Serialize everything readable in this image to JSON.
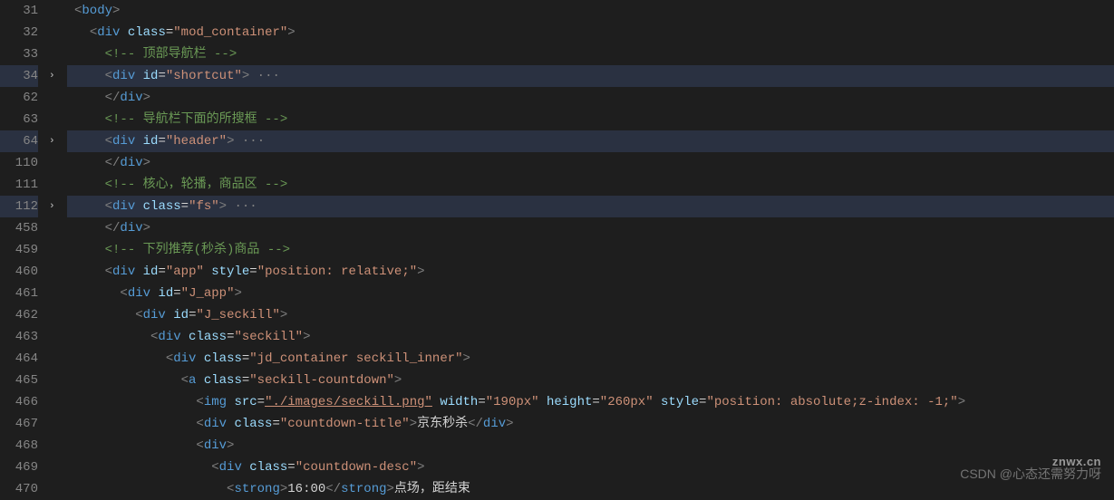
{
  "lines": [
    {
      "num": "31",
      "hl": false,
      "fold": false,
      "indent": 0,
      "tokens": [
        {
          "t": "tag-bracket",
          "v": "<"
        },
        {
          "t": "tag-name",
          "v": "body"
        },
        {
          "t": "tag-bracket",
          "v": ">"
        }
      ]
    },
    {
      "num": "32",
      "hl": false,
      "fold": false,
      "indent": 1,
      "tokens": [
        {
          "t": "tag-bracket",
          "v": "<"
        },
        {
          "t": "tag-name",
          "v": "div"
        },
        {
          "t": "text-content",
          "v": " "
        },
        {
          "t": "attr-name",
          "v": "class"
        },
        {
          "t": "text-content",
          "v": "="
        },
        {
          "t": "attr-value",
          "v": "\"mod_container\""
        },
        {
          "t": "tag-bracket",
          "v": ">"
        }
      ]
    },
    {
      "num": "33",
      "hl": false,
      "fold": false,
      "indent": 2,
      "tokens": [
        {
          "t": "comment",
          "v": "<!-- 顶部导航栏 -->"
        }
      ]
    },
    {
      "num": "34",
      "hl": true,
      "fold": true,
      "indent": 2,
      "tokens": [
        {
          "t": "tag-bracket",
          "v": "<"
        },
        {
          "t": "tag-name",
          "v": "div"
        },
        {
          "t": "text-content",
          "v": " "
        },
        {
          "t": "attr-name",
          "v": "id"
        },
        {
          "t": "text-content",
          "v": "="
        },
        {
          "t": "attr-value",
          "v": "\"shortcut\""
        },
        {
          "t": "tag-bracket",
          "v": ">"
        },
        {
          "t": "fold-dots",
          "v": " ···"
        }
      ]
    },
    {
      "num": "62",
      "hl": false,
      "fold": false,
      "indent": 2,
      "tokens": [
        {
          "t": "tag-bracket",
          "v": "</"
        },
        {
          "t": "tag-name",
          "v": "div"
        },
        {
          "t": "tag-bracket",
          "v": ">"
        }
      ]
    },
    {
      "num": "63",
      "hl": false,
      "fold": false,
      "indent": 2,
      "tokens": [
        {
          "t": "comment",
          "v": "<!-- 导航栏下面的所搜框 -->"
        }
      ]
    },
    {
      "num": "64",
      "hl": true,
      "fold": true,
      "indent": 2,
      "tokens": [
        {
          "t": "tag-bracket",
          "v": "<"
        },
        {
          "t": "tag-name",
          "v": "div"
        },
        {
          "t": "text-content",
          "v": " "
        },
        {
          "t": "attr-name",
          "v": "id"
        },
        {
          "t": "text-content",
          "v": "="
        },
        {
          "t": "attr-value",
          "v": "\"header\""
        },
        {
          "t": "tag-bracket",
          "v": ">"
        },
        {
          "t": "fold-dots",
          "v": " ···"
        }
      ]
    },
    {
      "num": "110",
      "hl": false,
      "fold": false,
      "indent": 2,
      "tokens": [
        {
          "t": "tag-bracket",
          "v": "</"
        },
        {
          "t": "tag-name",
          "v": "div"
        },
        {
          "t": "tag-bracket",
          "v": ">"
        }
      ]
    },
    {
      "num": "111",
      "hl": false,
      "fold": false,
      "indent": 2,
      "tokens": [
        {
          "t": "comment",
          "v": "<!-- 核心，轮播，商品区 -->"
        }
      ]
    },
    {
      "num": "112",
      "hl": true,
      "fold": true,
      "indent": 2,
      "tokens": [
        {
          "t": "tag-bracket",
          "v": "<"
        },
        {
          "t": "tag-name",
          "v": "div"
        },
        {
          "t": "text-content",
          "v": " "
        },
        {
          "t": "attr-name",
          "v": "class"
        },
        {
          "t": "text-content",
          "v": "="
        },
        {
          "t": "attr-value",
          "v": "\"fs\""
        },
        {
          "t": "tag-bracket",
          "v": ">"
        },
        {
          "t": "fold-dots",
          "v": " ···"
        }
      ]
    },
    {
      "num": "458",
      "hl": false,
      "fold": false,
      "indent": 2,
      "tokens": [
        {
          "t": "tag-bracket",
          "v": "</"
        },
        {
          "t": "tag-name",
          "v": "div"
        },
        {
          "t": "tag-bracket",
          "v": ">"
        }
      ]
    },
    {
      "num": "459",
      "hl": false,
      "fold": false,
      "indent": 2,
      "tokens": [
        {
          "t": "comment",
          "v": "<!-- 下列推荐(秒杀)商品 -->"
        }
      ]
    },
    {
      "num": "460",
      "hl": false,
      "fold": false,
      "indent": 2,
      "tokens": [
        {
          "t": "tag-bracket",
          "v": "<"
        },
        {
          "t": "tag-name",
          "v": "div"
        },
        {
          "t": "text-content",
          "v": " "
        },
        {
          "t": "attr-name",
          "v": "id"
        },
        {
          "t": "text-content",
          "v": "="
        },
        {
          "t": "attr-value",
          "v": "\"app\""
        },
        {
          "t": "text-content",
          "v": " "
        },
        {
          "t": "attr-name",
          "v": "style"
        },
        {
          "t": "text-content",
          "v": "="
        },
        {
          "t": "attr-value",
          "v": "\"position: relative;\""
        },
        {
          "t": "tag-bracket",
          "v": ">"
        }
      ]
    },
    {
      "num": "461",
      "hl": false,
      "fold": false,
      "indent": 3,
      "tokens": [
        {
          "t": "tag-bracket",
          "v": "<"
        },
        {
          "t": "tag-name",
          "v": "div"
        },
        {
          "t": "text-content",
          "v": " "
        },
        {
          "t": "attr-name",
          "v": "id"
        },
        {
          "t": "text-content",
          "v": "="
        },
        {
          "t": "attr-value",
          "v": "\"J_app\""
        },
        {
          "t": "tag-bracket",
          "v": ">"
        }
      ]
    },
    {
      "num": "462",
      "hl": false,
      "fold": false,
      "indent": 4,
      "tokens": [
        {
          "t": "tag-bracket",
          "v": "<"
        },
        {
          "t": "tag-name",
          "v": "div"
        },
        {
          "t": "text-content",
          "v": " "
        },
        {
          "t": "attr-name",
          "v": "id"
        },
        {
          "t": "text-content",
          "v": "="
        },
        {
          "t": "attr-value",
          "v": "\"J_seckill\""
        },
        {
          "t": "tag-bracket",
          "v": ">"
        }
      ]
    },
    {
      "num": "463",
      "hl": false,
      "fold": false,
      "indent": 5,
      "tokens": [
        {
          "t": "tag-bracket",
          "v": "<"
        },
        {
          "t": "tag-name",
          "v": "div"
        },
        {
          "t": "text-content",
          "v": " "
        },
        {
          "t": "attr-name",
          "v": "class"
        },
        {
          "t": "text-content",
          "v": "="
        },
        {
          "t": "attr-value",
          "v": "\"seckill\""
        },
        {
          "t": "tag-bracket",
          "v": ">"
        }
      ]
    },
    {
      "num": "464",
      "hl": false,
      "fold": false,
      "indent": 6,
      "tokens": [
        {
          "t": "tag-bracket",
          "v": "<"
        },
        {
          "t": "tag-name",
          "v": "div"
        },
        {
          "t": "text-content",
          "v": " "
        },
        {
          "t": "attr-name",
          "v": "class"
        },
        {
          "t": "text-content",
          "v": "="
        },
        {
          "t": "attr-value",
          "v": "\"jd_container seckill_inner\""
        },
        {
          "t": "tag-bracket",
          "v": ">"
        }
      ]
    },
    {
      "num": "465",
      "hl": false,
      "fold": false,
      "indent": 7,
      "tokens": [
        {
          "t": "tag-bracket",
          "v": "<"
        },
        {
          "t": "tag-name",
          "v": "a"
        },
        {
          "t": "text-content",
          "v": " "
        },
        {
          "t": "attr-name",
          "v": "class"
        },
        {
          "t": "text-content",
          "v": "="
        },
        {
          "t": "attr-value",
          "v": "\"seckill-countdown\""
        },
        {
          "t": "tag-bracket",
          "v": ">"
        }
      ]
    },
    {
      "num": "466",
      "hl": false,
      "fold": false,
      "indent": 8,
      "tokens": [
        {
          "t": "tag-bracket",
          "v": "<"
        },
        {
          "t": "tag-name",
          "v": "img"
        },
        {
          "t": "text-content",
          "v": " "
        },
        {
          "t": "attr-name",
          "v": "src"
        },
        {
          "t": "text-content",
          "v": "="
        },
        {
          "t": "attr-value underline",
          "v": "\"./images/seckill.png\""
        },
        {
          "t": "text-content",
          "v": " "
        },
        {
          "t": "attr-name",
          "v": "width"
        },
        {
          "t": "text-content",
          "v": "="
        },
        {
          "t": "attr-value",
          "v": "\"190px\""
        },
        {
          "t": "text-content",
          "v": " "
        },
        {
          "t": "attr-name",
          "v": "height"
        },
        {
          "t": "text-content",
          "v": "="
        },
        {
          "t": "attr-value",
          "v": "\"260px\""
        },
        {
          "t": "text-content",
          "v": " "
        },
        {
          "t": "attr-name",
          "v": "style"
        },
        {
          "t": "text-content",
          "v": "="
        },
        {
          "t": "attr-value",
          "v": "\"position: absolute;z-index: -1;\""
        },
        {
          "t": "tag-bracket",
          "v": ">"
        }
      ]
    },
    {
      "num": "467",
      "hl": false,
      "fold": false,
      "indent": 8,
      "tokens": [
        {
          "t": "tag-bracket",
          "v": "<"
        },
        {
          "t": "tag-name",
          "v": "div"
        },
        {
          "t": "text-content",
          "v": " "
        },
        {
          "t": "attr-name",
          "v": "class"
        },
        {
          "t": "text-content",
          "v": "="
        },
        {
          "t": "attr-value",
          "v": "\"countdown-title\""
        },
        {
          "t": "tag-bracket",
          "v": ">"
        },
        {
          "t": "text-content",
          "v": "京东秒杀"
        },
        {
          "t": "tag-bracket",
          "v": "</"
        },
        {
          "t": "tag-name",
          "v": "div"
        },
        {
          "t": "tag-bracket",
          "v": ">"
        }
      ]
    },
    {
      "num": "468",
      "hl": false,
      "fold": false,
      "indent": 8,
      "tokens": [
        {
          "t": "tag-bracket",
          "v": "<"
        },
        {
          "t": "tag-name",
          "v": "div"
        },
        {
          "t": "tag-bracket",
          "v": ">"
        }
      ]
    },
    {
      "num": "469",
      "hl": false,
      "fold": false,
      "indent": 9,
      "tokens": [
        {
          "t": "tag-bracket",
          "v": "<"
        },
        {
          "t": "tag-name",
          "v": "div"
        },
        {
          "t": "text-content",
          "v": " "
        },
        {
          "t": "attr-name",
          "v": "class"
        },
        {
          "t": "text-content",
          "v": "="
        },
        {
          "t": "attr-value",
          "v": "\"countdown-desc\""
        },
        {
          "t": "tag-bracket",
          "v": ">"
        }
      ]
    },
    {
      "num": "470",
      "hl": false,
      "fold": false,
      "indent": 10,
      "tokens": [
        {
          "t": "tag-bracket",
          "v": "<"
        },
        {
          "t": "tag-name",
          "v": "strong"
        },
        {
          "t": "tag-bracket",
          "v": ">"
        },
        {
          "t": "text-content",
          "v": "16:00"
        },
        {
          "t": "tag-bracket",
          "v": "</"
        },
        {
          "t": "tag-name",
          "v": "strong"
        },
        {
          "t": "tag-bracket",
          "v": ">"
        },
        {
          "t": "text-content",
          "v": "点场，距结束"
        }
      ]
    }
  ],
  "watermark_text": "CSDN @心态还需努力呀",
  "watermark_logo": "znwx.cn"
}
